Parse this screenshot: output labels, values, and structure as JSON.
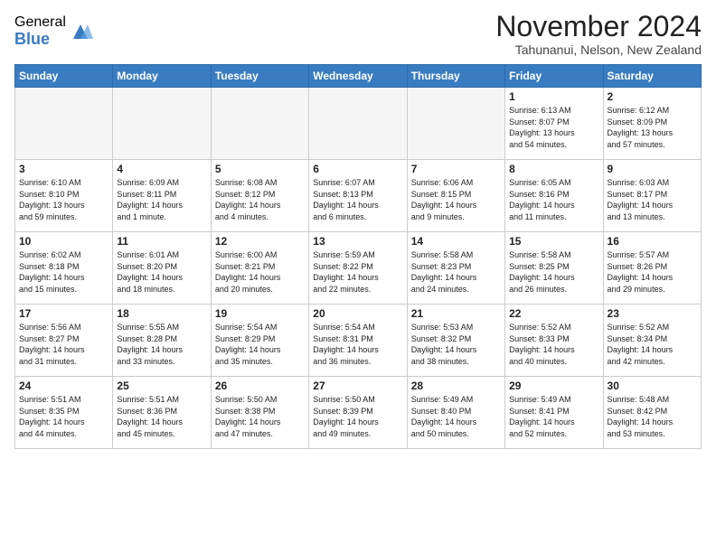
{
  "logo": {
    "general": "General",
    "blue": "Blue"
  },
  "title": "November 2024",
  "location": "Tahunanui, Nelson, New Zealand",
  "headers": [
    "Sunday",
    "Monday",
    "Tuesday",
    "Wednesday",
    "Thursday",
    "Friday",
    "Saturday"
  ],
  "weeks": [
    [
      {
        "day": "",
        "info": ""
      },
      {
        "day": "",
        "info": ""
      },
      {
        "day": "",
        "info": ""
      },
      {
        "day": "",
        "info": ""
      },
      {
        "day": "",
        "info": ""
      },
      {
        "day": "1",
        "info": "Sunrise: 6:13 AM\nSunset: 8:07 PM\nDaylight: 13 hours\nand 54 minutes."
      },
      {
        "day": "2",
        "info": "Sunrise: 6:12 AM\nSunset: 8:09 PM\nDaylight: 13 hours\nand 57 minutes."
      }
    ],
    [
      {
        "day": "3",
        "info": "Sunrise: 6:10 AM\nSunset: 8:10 PM\nDaylight: 13 hours\nand 59 minutes."
      },
      {
        "day": "4",
        "info": "Sunrise: 6:09 AM\nSunset: 8:11 PM\nDaylight: 14 hours\nand 1 minute."
      },
      {
        "day": "5",
        "info": "Sunrise: 6:08 AM\nSunset: 8:12 PM\nDaylight: 14 hours\nand 4 minutes."
      },
      {
        "day": "6",
        "info": "Sunrise: 6:07 AM\nSunset: 8:13 PM\nDaylight: 14 hours\nand 6 minutes."
      },
      {
        "day": "7",
        "info": "Sunrise: 6:06 AM\nSunset: 8:15 PM\nDaylight: 14 hours\nand 9 minutes."
      },
      {
        "day": "8",
        "info": "Sunrise: 6:05 AM\nSunset: 8:16 PM\nDaylight: 14 hours\nand 11 minutes."
      },
      {
        "day": "9",
        "info": "Sunrise: 6:03 AM\nSunset: 8:17 PM\nDaylight: 14 hours\nand 13 minutes."
      }
    ],
    [
      {
        "day": "10",
        "info": "Sunrise: 6:02 AM\nSunset: 8:18 PM\nDaylight: 14 hours\nand 15 minutes."
      },
      {
        "day": "11",
        "info": "Sunrise: 6:01 AM\nSunset: 8:20 PM\nDaylight: 14 hours\nand 18 minutes."
      },
      {
        "day": "12",
        "info": "Sunrise: 6:00 AM\nSunset: 8:21 PM\nDaylight: 14 hours\nand 20 minutes."
      },
      {
        "day": "13",
        "info": "Sunrise: 5:59 AM\nSunset: 8:22 PM\nDaylight: 14 hours\nand 22 minutes."
      },
      {
        "day": "14",
        "info": "Sunrise: 5:58 AM\nSunset: 8:23 PM\nDaylight: 14 hours\nand 24 minutes."
      },
      {
        "day": "15",
        "info": "Sunrise: 5:58 AM\nSunset: 8:25 PM\nDaylight: 14 hours\nand 26 minutes."
      },
      {
        "day": "16",
        "info": "Sunrise: 5:57 AM\nSunset: 8:26 PM\nDaylight: 14 hours\nand 29 minutes."
      }
    ],
    [
      {
        "day": "17",
        "info": "Sunrise: 5:56 AM\nSunset: 8:27 PM\nDaylight: 14 hours\nand 31 minutes."
      },
      {
        "day": "18",
        "info": "Sunrise: 5:55 AM\nSunset: 8:28 PM\nDaylight: 14 hours\nand 33 minutes."
      },
      {
        "day": "19",
        "info": "Sunrise: 5:54 AM\nSunset: 8:29 PM\nDaylight: 14 hours\nand 35 minutes."
      },
      {
        "day": "20",
        "info": "Sunrise: 5:54 AM\nSunset: 8:31 PM\nDaylight: 14 hours\nand 36 minutes."
      },
      {
        "day": "21",
        "info": "Sunrise: 5:53 AM\nSunset: 8:32 PM\nDaylight: 14 hours\nand 38 minutes."
      },
      {
        "day": "22",
        "info": "Sunrise: 5:52 AM\nSunset: 8:33 PM\nDaylight: 14 hours\nand 40 minutes."
      },
      {
        "day": "23",
        "info": "Sunrise: 5:52 AM\nSunset: 8:34 PM\nDaylight: 14 hours\nand 42 minutes."
      }
    ],
    [
      {
        "day": "24",
        "info": "Sunrise: 5:51 AM\nSunset: 8:35 PM\nDaylight: 14 hours\nand 44 minutes."
      },
      {
        "day": "25",
        "info": "Sunrise: 5:51 AM\nSunset: 8:36 PM\nDaylight: 14 hours\nand 45 minutes."
      },
      {
        "day": "26",
        "info": "Sunrise: 5:50 AM\nSunset: 8:38 PM\nDaylight: 14 hours\nand 47 minutes."
      },
      {
        "day": "27",
        "info": "Sunrise: 5:50 AM\nSunset: 8:39 PM\nDaylight: 14 hours\nand 49 minutes."
      },
      {
        "day": "28",
        "info": "Sunrise: 5:49 AM\nSunset: 8:40 PM\nDaylight: 14 hours\nand 50 minutes."
      },
      {
        "day": "29",
        "info": "Sunrise: 5:49 AM\nSunset: 8:41 PM\nDaylight: 14 hours\nand 52 minutes."
      },
      {
        "day": "30",
        "info": "Sunrise: 5:48 AM\nSunset: 8:42 PM\nDaylight: 14 hours\nand 53 minutes."
      }
    ]
  ]
}
